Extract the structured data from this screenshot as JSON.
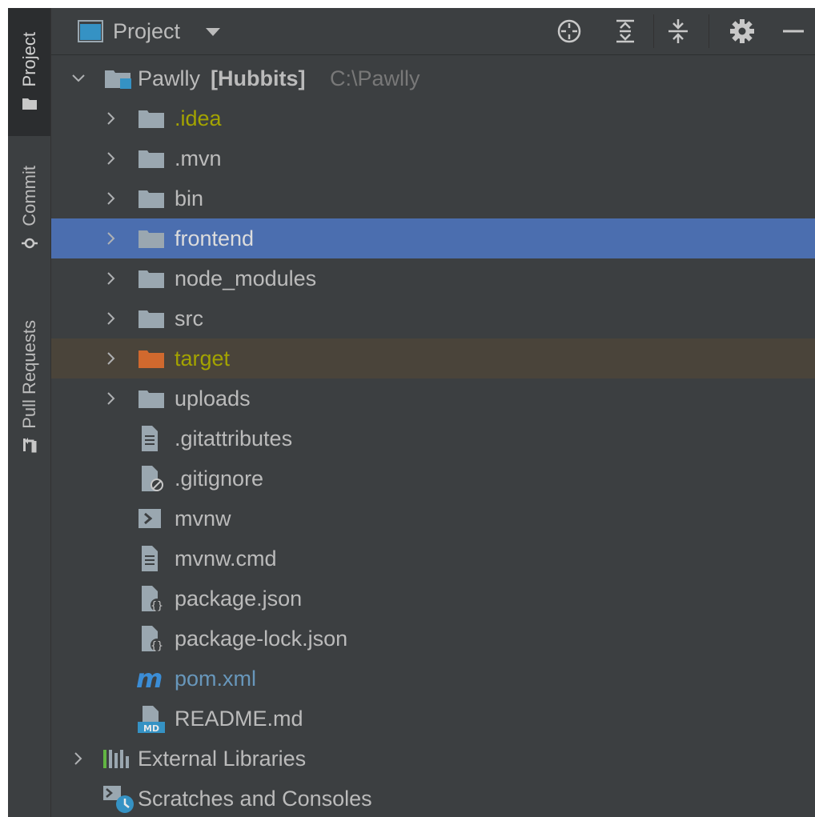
{
  "stripe": {
    "project_label": "Project",
    "commit_label": "Commit",
    "pull_requests_label": "Pull Requests"
  },
  "header": {
    "title": "Project",
    "icons": [
      "locate-icon",
      "expand-all-icon",
      "collapse-all-icon",
      "settings-icon",
      "minimize-icon"
    ]
  },
  "tree": {
    "root": {
      "name": "Pawlly",
      "module": "[Hubbits]",
      "path": "C:\\Pawlly"
    },
    "folders": [
      {
        "label": ".idea"
      },
      {
        "label": ".mvn"
      },
      {
        "label": "bin"
      },
      {
        "label": "frontend"
      },
      {
        "label": "node_modules"
      },
      {
        "label": "src"
      },
      {
        "label": "target"
      },
      {
        "label": "uploads"
      }
    ],
    "files": [
      {
        "label": ".gitattributes"
      },
      {
        "label": ".gitignore"
      },
      {
        "label": "mvnw"
      },
      {
        "label": "mvnw.cmd"
      },
      {
        "label": "package.json"
      },
      {
        "label": "package-lock.json"
      },
      {
        "label": "pom.xml"
      },
      {
        "label": "README.md"
      }
    ],
    "external_libraries": "External Libraries",
    "scratches": "Scratches and Consoles"
  },
  "colors": {
    "selection": "#4b6eaf",
    "excluded_background": "#4a443a",
    "excluded_folder": "#d0692e",
    "ignored_text": "#a3a300",
    "maven_blue": "#3b8dd6"
  }
}
